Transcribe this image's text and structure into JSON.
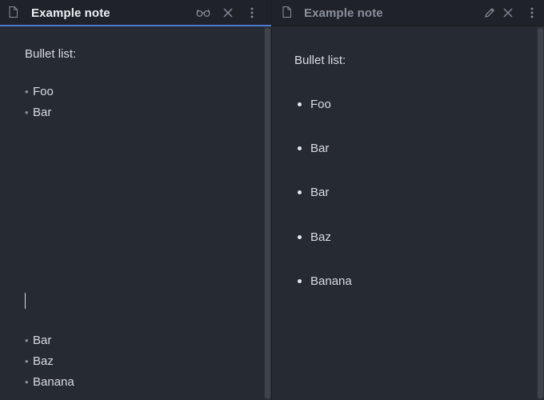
{
  "left_pane": {
    "tab_title": "Example note",
    "doc_icon": "document-icon",
    "actions": [
      "reading-view-icon",
      "close-icon",
      "more-options-icon"
    ],
    "editor": {
      "heading": "Bullet list:",
      "top_items": [
        "Foo",
        "Bar"
      ],
      "bottom_items": [
        "Bar",
        "Baz",
        "Banana"
      ],
      "bullet_char": "•"
    }
  },
  "right_pane": {
    "tab_title": "Example note",
    "doc_icon": "document-icon",
    "actions": [
      "edit-pencil-icon",
      "close-icon",
      "more-options-icon"
    ],
    "preview": {
      "heading": "Bullet list:",
      "items": [
        "Foo",
        "Bar",
        "Bar",
        "Baz",
        "Banana"
      ]
    }
  },
  "colors": {
    "background": "#262a33",
    "tabbar": "#1f2229",
    "active_tab_accent": "#4d78cc",
    "text": "#d8dbe2",
    "muted_text": "#8a909c"
  }
}
